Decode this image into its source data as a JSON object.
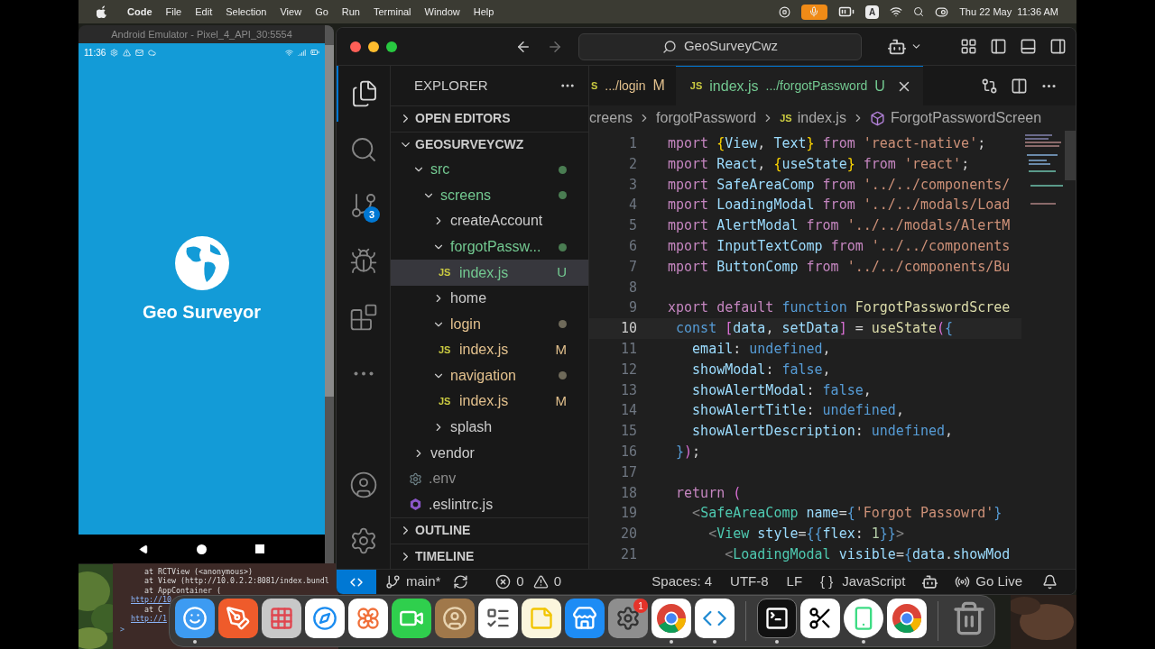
{
  "menu_bar": {
    "app": "Code",
    "items": [
      "File",
      "Edit",
      "Selection",
      "View",
      "Go",
      "Run",
      "Terminal",
      "Window",
      "Help"
    ],
    "input_source": "A",
    "clock": "Thu 22 May  11:36 AM"
  },
  "emulator": {
    "title": "Android Emulator - Pixel_4_API_30:5554",
    "status_time": "11:36",
    "app_name": "Geo Surveyor"
  },
  "terminal": {
    "lines": [
      {
        "kind": "trace",
        "text": "at RCTView (<anonymous>)"
      },
      {
        "kind": "trace",
        "text": "at View (http://10.0.2.2:8081/index.bundl"
      },
      {
        "kind": "trace",
        "text": "at AppContainer ("
      },
      {
        "kind": "link",
        "text": "http://10"
      },
      {
        "kind": "trace",
        "text": "at C"
      },
      {
        "kind": "link",
        "text": "http://1"
      }
    ],
    "prompt": ">"
  },
  "vscode": {
    "command_center": "GeoSurveyCwz",
    "activity_bar": [
      {
        "kind": "explorer",
        "selected": true
      },
      {
        "kind": "search",
        "selected": false
      },
      {
        "kind": "source_control",
        "selected": false,
        "badge": "3"
      },
      {
        "kind": "run",
        "selected": false
      },
      {
        "kind": "extensions",
        "selected": false
      },
      {
        "kind": "more",
        "selected": false
      }
    ],
    "activity_bottom": [
      {
        "kind": "account"
      },
      {
        "kind": "settings"
      }
    ],
    "sidebar": {
      "title": "EXPLORER",
      "sections": [
        {
          "label": "OPEN EDITORS",
          "expanded": false
        },
        {
          "label": "GEOSURVEYCWZ",
          "expanded": true,
          "tree": [
            {
              "name": "src",
              "kind": "folder",
              "expanded": true,
              "color": "#73c991",
              "dot": true,
              "selected": false,
              "children": [
                {
                  "name": "screens",
                  "kind": "folder",
                  "expanded": true,
                  "color": "#73c991",
                  "dot": true,
                  "selected": false,
                  "children": [
                    {
                      "name": "createAccount",
                      "kind": "folder",
                      "expanded": false,
                      "color": "#cccccc",
                      "dot": false,
                      "selected": false
                    },
                    {
                      "name": "forgotPassw...",
                      "kind": "folder",
                      "expanded": true,
                      "color": "#73c991",
                      "dot": true,
                      "selected": false,
                      "children": [
                        {
                          "name": "index.js",
                          "kind": "js",
                          "icon_text": "JS",
                          "color": "#73c991",
                          "badge": "U",
                          "selected": true
                        }
                      ]
                    },
                    {
                      "name": "home",
                      "kind": "folder",
                      "expanded": false,
                      "color": "#cccccc",
                      "dot": false,
                      "selected": false
                    },
                    {
                      "name": "login",
                      "kind": "folder",
                      "expanded": true,
                      "color": "#e2c08d",
                      "dot": true,
                      "selected": false,
                      "children": [
                        {
                          "name": "index.js",
                          "kind": "js",
                          "icon_text": "JS",
                          "color": "#e2c08d",
                          "badge": "M",
                          "selected": false
                        }
                      ]
                    },
                    {
                      "name": "navigation",
                      "kind": "folder",
                      "expanded": true,
                      "color": "#e2c08d",
                      "dot": true,
                      "selected": false,
                      "children": [
                        {
                          "name": "index.js",
                          "kind": "js",
                          "icon_text": "JS",
                          "color": "#e2c08d",
                          "badge": "M",
                          "selected": false
                        }
                      ]
                    },
                    {
                      "name": "splash",
                      "kind": "folder",
                      "expanded": false,
                      "color": "#cccccc",
                      "dot": false,
                      "selected": false
                    }
                  ]
                }
              ]
            },
            {
              "name": "vendor",
              "kind": "folder",
              "expanded": false,
              "color": "#cccccc",
              "dot": false,
              "selected": false
            },
            {
              "name": ".env",
              "kind": "config",
              "color": "#8c8c8c",
              "selected": false
            },
            {
              "name": ".eslintrc.js",
              "kind": "eslint",
              "color": "#cccccc",
              "selected": false
            }
          ]
        },
        {
          "label": "OUTLINE",
          "expanded": false
        },
        {
          "label": "TIMELINE",
          "expanded": false
        }
      ]
    },
    "tabs": [
      {
        "icon_text": "S",
        "path": ".../login",
        "badge": "M",
        "color": "#e2c08d",
        "selected": false
      },
      {
        "icon_text": "JS",
        "name": "index.js",
        "path": ".../forgotPassword",
        "badge": "U",
        "color": "#73c991",
        "selected": true
      }
    ],
    "breadcrumbs": [
      {
        "kind": "folder",
        "label": "creens"
      },
      {
        "kind": "folder",
        "label": "forgotPassword"
      },
      {
        "kind": "file",
        "icon_text": "JS",
        "label": "index.js"
      },
      {
        "kind": "symbol",
        "label": "ForgotPasswordScreen"
      }
    ],
    "code": [
      {
        "number": "1",
        "current": false,
        "text": "mport {View, Text} from 'react-native';"
      },
      {
        "number": "2",
        "current": false,
        "text": "mport React, {useState} from 'react';"
      },
      {
        "number": "3",
        "current": false,
        "text": "mport SafeAreaComp from '../../components/"
      },
      {
        "number": "4",
        "current": false,
        "text": "mport LoadingModal from '../../modals/Load"
      },
      {
        "number": "5",
        "current": false,
        "text": "mport AlertModal from '../../modals/AlertM"
      },
      {
        "number": "6",
        "current": false,
        "text": "mport InputTextComp from '../../components"
      },
      {
        "number": "7",
        "current": false,
        "text": "mport ButtonComp from '../../components/Bu"
      },
      {
        "number": "8",
        "current": false
      },
      {
        "number": "9",
        "current": false,
        "text": "xport default function ForgotPasswordScree"
      },
      {
        "number": "10",
        "current": true,
        "text": " const [data, setData] = useState({"
      },
      {
        "number": "11",
        "current": false,
        "text": "   email: undefined,"
      },
      {
        "number": "12",
        "current": false,
        "text": "   showModal: false,"
      },
      {
        "number": "13",
        "current": false,
        "text": "   showAlertModal: false,"
      },
      {
        "number": "14",
        "current": false,
        "text": "   showAlertTitle: undefined,"
      },
      {
        "number": "15",
        "current": false,
        "text": "   showAlertDescription: undefined,"
      },
      {
        "number": "16",
        "current": false,
        "text": " });"
      },
      {
        "number": "17",
        "current": false
      },
      {
        "number": "18",
        "current": false,
        "text": " return ("
      },
      {
        "number": "19",
        "current": false,
        "text": "   <SafeAreaComp name={'Forgot Passowrd'}"
      },
      {
        "number": "20",
        "current": false,
        "text": "     <View style={{flex: 1}}>"
      },
      {
        "number": "21",
        "current": false,
        "text": "       <LoadingModal visible={data.showMod"
      }
    ],
    "status_bar": [
      {
        "kind": "remote"
      },
      {
        "kind": "branch",
        "text": "main*"
      },
      {
        "kind": "sync"
      },
      {
        "kind": "problems",
        "errors": "0",
        "warnings": "0"
      },
      {
        "kind": "text",
        "text": "Spaces: 4"
      },
      {
        "kind": "text",
        "text": "UTF-8"
      },
      {
        "kind": "text",
        "text": "LF"
      },
      {
        "kind": "language",
        "icon_text": "{ }",
        "text": "JavaScript"
      },
      {
        "kind": "copilot"
      },
      {
        "kind": "go_live",
        "text": "Go Live"
      },
      {
        "kind": "bell"
      }
    ]
  },
  "dock": {
    "groups": [
      {
        "items": [
          {
            "kind": "finder",
            "running": true
          },
          {
            "kind": "postman",
            "running": false
          },
          {
            "kind": "launchpad",
            "running": false
          },
          {
            "kind": "safari",
            "running": false
          },
          {
            "kind": "photos",
            "running": false
          },
          {
            "kind": "facetime",
            "running": false
          },
          {
            "kind": "contacts",
            "running": false
          },
          {
            "kind": "reminders",
            "running": false
          },
          {
            "kind": "notes",
            "running": false
          },
          {
            "kind": "appstore",
            "running": false
          },
          {
            "kind": "settings",
            "running": false,
            "badge": "1"
          },
          {
            "kind": "chrome",
            "running": true
          },
          {
            "kind": "vscode",
            "running": true
          }
        ]
      },
      {
        "items": [
          {
            "kind": "terminal",
            "running": true
          },
          {
            "kind": "capcut",
            "running": false
          },
          {
            "kind": "android",
            "running": true
          },
          {
            "kind": "chrome",
            "running": false
          }
        ]
      },
      {
        "items": [
          {
            "kind": "trash",
            "running": false
          }
        ]
      }
    ]
  }
}
